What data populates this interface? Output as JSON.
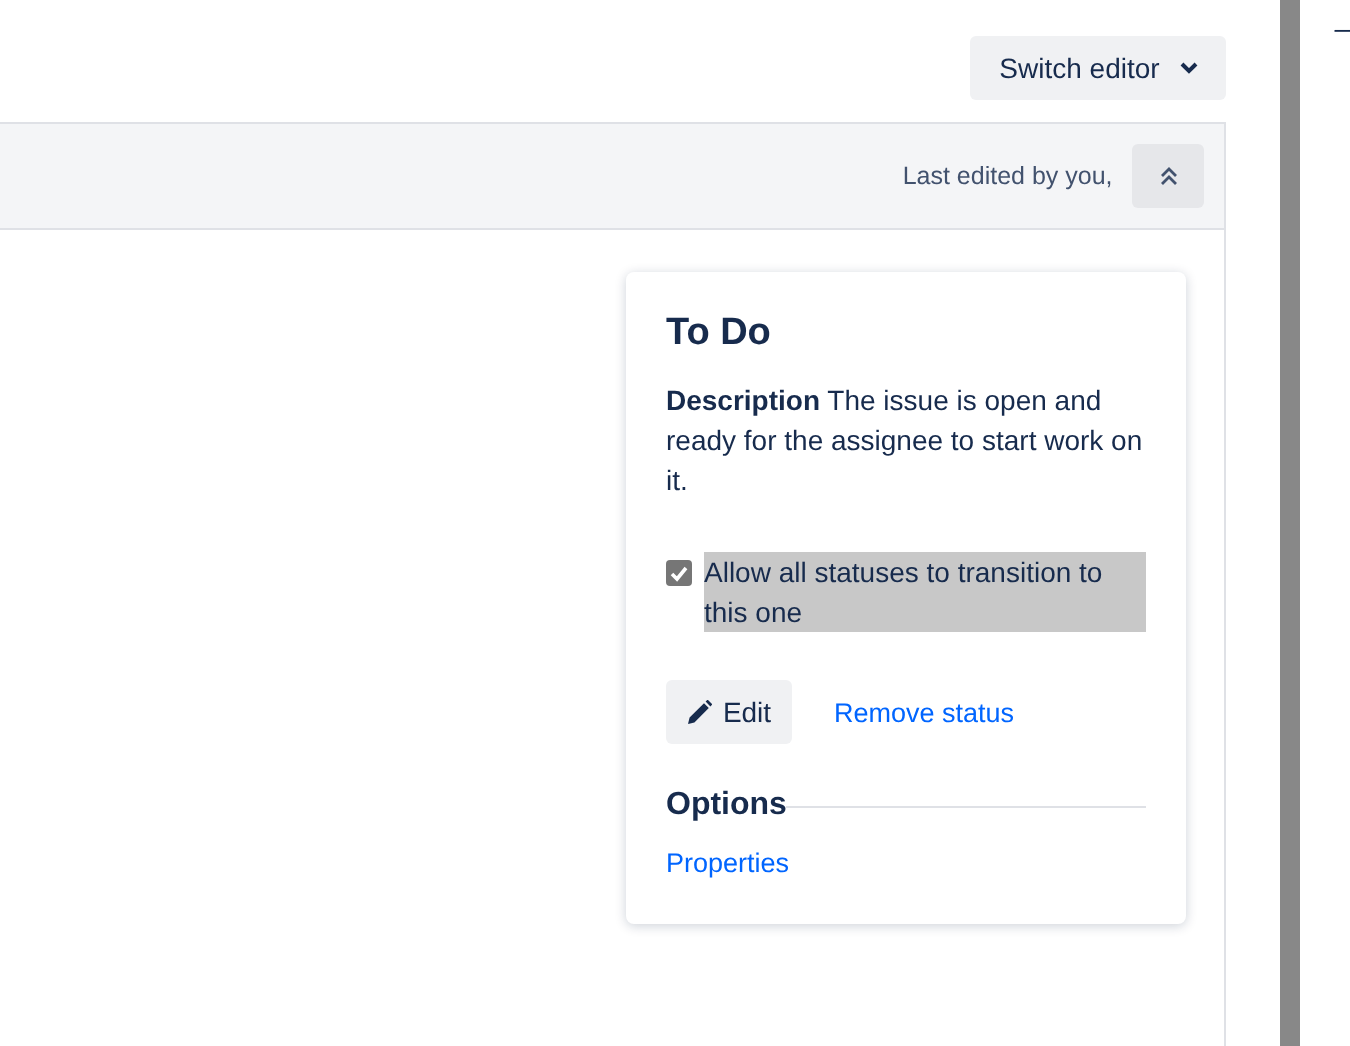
{
  "toolbar": {
    "switch_editor": "Switch editor"
  },
  "header": {
    "last_edited": "Last edited by you,"
  },
  "status_card": {
    "title": "To Do",
    "description_label": "Description",
    "description": "The issue is open and ready for the assignee to start work on it.",
    "allow_all": {
      "label": "Allow all statuses to transition to this one",
      "checked": true,
      "highlighted": true
    },
    "edit_button": "Edit",
    "remove_link": "Remove status",
    "options_heading": "Options",
    "properties_link": "Properties"
  },
  "side_panel": {
    "dash": "–"
  }
}
